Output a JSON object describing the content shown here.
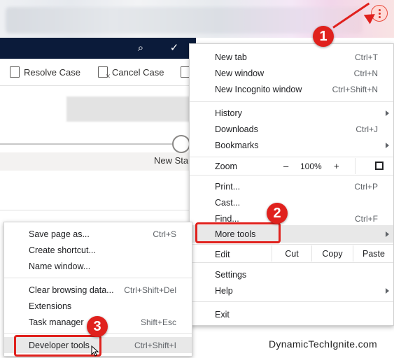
{
  "command_bar": {
    "resolve_case": "Resolve Case",
    "cancel_case": "Cancel Case"
  },
  "stage": {
    "label": "New Sta"
  },
  "main_menu": {
    "items": [
      {
        "label": "New tab",
        "shortcut": "Ctrl+T"
      },
      {
        "label": "New window",
        "shortcut": "Ctrl+N"
      },
      {
        "label": "New Incognito window",
        "shortcut": "Ctrl+Shift+N"
      },
      {
        "label": "History",
        "shortcut": ""
      },
      {
        "label": "Downloads",
        "shortcut": "Ctrl+J"
      },
      {
        "label": "Bookmarks",
        "shortcut": ""
      },
      {
        "label": "Print...",
        "shortcut": "Ctrl+P"
      },
      {
        "label": "Cast...",
        "shortcut": ""
      },
      {
        "label": "Find...",
        "shortcut": "Ctrl+F"
      },
      {
        "label": "More tools",
        "shortcut": ""
      },
      {
        "label": "Settings",
        "shortcut": ""
      },
      {
        "label": "Help",
        "shortcut": ""
      },
      {
        "label": "Exit",
        "shortcut": ""
      }
    ],
    "zoom": {
      "label": "Zoom",
      "minus": "–",
      "value": "100%",
      "plus": "+"
    },
    "edit": {
      "label": "Edit",
      "cut": "Cut",
      "copy": "Copy",
      "paste": "Paste"
    }
  },
  "more_tools_menu": {
    "items": [
      {
        "label": "Save page as...",
        "shortcut": "Ctrl+S"
      },
      {
        "label": "Create shortcut...",
        "shortcut": ""
      },
      {
        "label": "Name window...",
        "shortcut": ""
      },
      {
        "label": "Clear browsing data...",
        "shortcut": "Ctrl+Shift+Del"
      },
      {
        "label": "Extensions",
        "shortcut": ""
      },
      {
        "label": "Task manager",
        "shortcut": "Shift+Esc"
      },
      {
        "label": "Developer tools",
        "shortcut": "Ctrl+Shift+I"
      }
    ]
  },
  "annotations": {
    "step1": "1",
    "step2": "2",
    "step3": "3"
  },
  "watermark": "DynamicTechIgnite.com",
  "colors": {
    "annotation_red": "#e0211d",
    "app_header": "#0b1b3a",
    "menu_highlight": "#e8e8e8"
  }
}
